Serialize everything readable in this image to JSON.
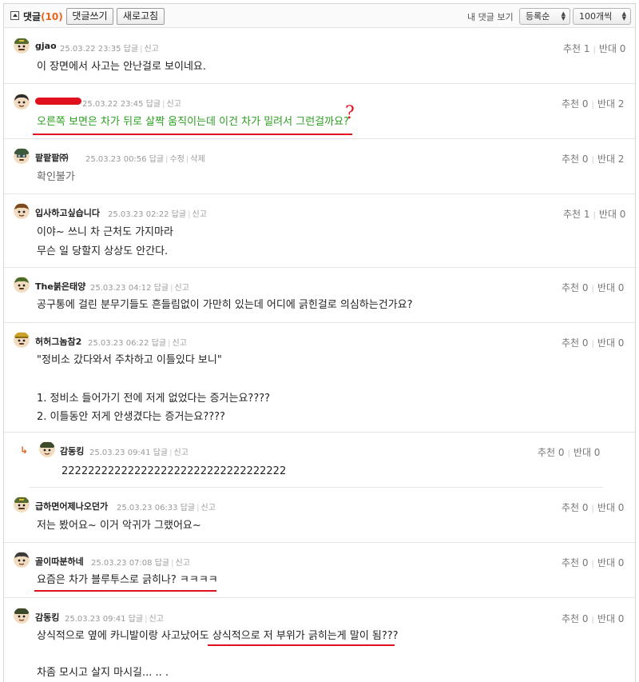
{
  "toolbar": {
    "title": "댓글",
    "count": "(10)",
    "write_button": "댓글쓰기",
    "refresh_button": "새로고침",
    "my_comments_link": "내 댓글 보기",
    "sort_select": "등록순",
    "per_page_select": "100개씩"
  },
  "comments": [
    {
      "nick": "gjao",
      "date": "25.03.22 23:35",
      "actions": [
        "답글",
        "신고"
      ],
      "up": "추천 1",
      "down": "반대 0",
      "lines": [
        "이 장면에서 사고는 안난걸로 보이네요."
      ]
    },
    {
      "nick": "",
      "date": "25.03.22 23:45",
      "actions": [
        "답글",
        "신고"
      ],
      "up": "추천 0",
      "down": "반대 2",
      "lines": [
        "오른쪽 보면은 차가 뒤로 살짝 움직이는데 이건 차가 밀려서 그런걸까요?"
      ],
      "annotation": "?"
    },
    {
      "nick": "팥팥팥㈜",
      "date": "25.03.23 00:56",
      "actions": [
        "답글",
        "수정",
        "삭제"
      ],
      "up": "추천 0",
      "down": "반대 2",
      "lines": [
        "확인불가"
      ]
    },
    {
      "nick": "입사하고싶습니다",
      "date": "25.03.23 02:22",
      "actions": [
        "답글",
        "신고"
      ],
      "up": "추천 1",
      "down": "반대 0",
      "lines": [
        "이야~ 쓰니 차 근처도 가지마라",
        "무슨 일 당할지 상상도 안간다."
      ]
    },
    {
      "nick": "The붉은태양",
      "date": "25.03.23 04:12",
      "actions": [
        "답글",
        "신고"
      ],
      "up": "추천 0",
      "down": "반대 0",
      "lines": [
        "공구통에 걸린 분무기들도 흔들림없이 가만히 있는데 어디에 긁힌걸로 의심하는건가요?"
      ]
    },
    {
      "nick": "허허그놈참2",
      "date": "25.03.23 06:22",
      "actions": [
        "답글",
        "신고"
      ],
      "up": "추천 0",
      "down": "반대 0",
      "lines": [
        "\"정비소 갔다와서 주차하고 이틀있다 보니\"",
        "",
        "1. 정비소 들어가기 전에 저게 없었다는 증거는요????",
        "2. 이틀동안 저게 안생겼다는 증거는요????"
      ]
    },
    {
      "nick": "감동킹",
      "date": "25.03.23 09:41",
      "actions": [
        "답글",
        "신고"
      ],
      "up": "추천 0",
      "down": "반대 0",
      "lines": [
        "2222222222222222222222222222222222"
      ],
      "reply_marker": "↳"
    },
    {
      "nick": "급하면어제나오던가",
      "date": "25.03.23 06:33",
      "actions": [
        "답글",
        "신고"
      ],
      "up": "추천 0",
      "down": "반대 0",
      "lines": [
        "저는 봤어요~ 이거 악귀가 그랬어요~"
      ]
    },
    {
      "nick": "골이따분하네",
      "date": "25.03.23 07:08",
      "actions": [
        "답글",
        "신고"
      ],
      "up": "추천 0",
      "down": "반대 0",
      "lines": [
        "요즘은 차가 블루투스로 긁히나? ㅋㅋㅋㅋ"
      ]
    },
    {
      "nick": "감동킹",
      "date": "25.03.23 09:41",
      "actions": [
        "답글",
        "신고"
      ],
      "up": "추천 0",
      "down": "반대 0",
      "lines": [
        "상식적으로 옆에 카니발이랑 사고났어도 상식적으로 저 부위가 긁히는게 말이 됨???",
        "",
        "차좀 모시고 살지 마시길... .. ."
      ]
    }
  ],
  "colors": {
    "accent": "#e8641b",
    "highlight_green": "#2a9f1e",
    "annotation_red": "#e0101c"
  }
}
